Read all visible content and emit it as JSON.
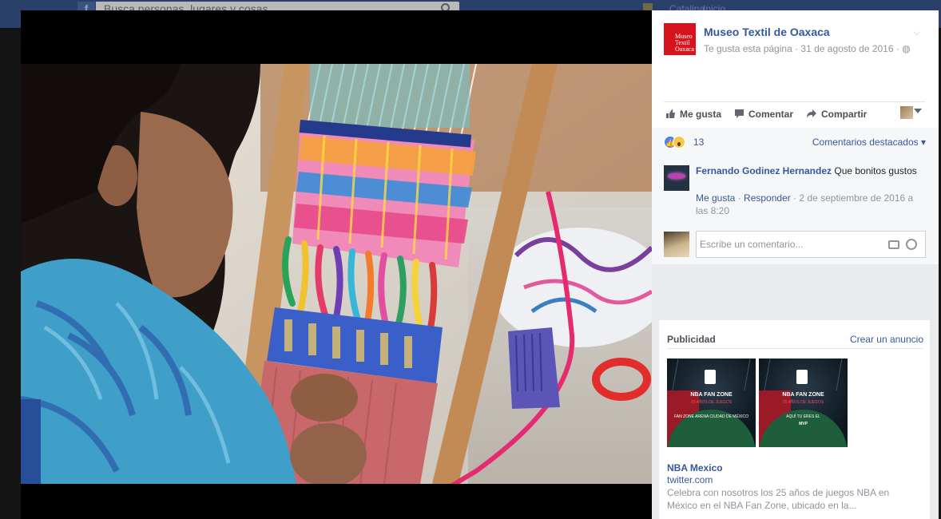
{
  "topbar": {
    "logo": "f",
    "search_placeholder": "Busca personas, lugares y cosas",
    "nav_b": "Catalina",
    "nav_c": "Inicio"
  },
  "post": {
    "page_name": "Museo Textil de Oaxaca",
    "logo_text_1": "Museo",
    "logo_text_2": "Textil",
    "logo_text_3": "Oaxaca",
    "meta": "Te gusta esta página · 31 de agosto de 2016 · ",
    "globe_icon": "globe-icon"
  },
  "actions": {
    "like": "Me gusta",
    "comment": "Comentar",
    "share": "Compartir"
  },
  "reactions": {
    "count": "13",
    "top_comments": "Comentarios destacados"
  },
  "comment": {
    "author": "Fernando Godinez Hernandez",
    "text": "Que bonitos gustos",
    "like": "Me gusta",
    "reply": "Responder",
    "timestamp": "2 de septiembre de 2016 a las 8:20"
  },
  "comment_input": {
    "placeholder": "Escribe un comentario..."
  },
  "ads": {
    "title": "Publicidad",
    "create": "Crear un anuncio",
    "image_text_a": [
      "NBA FAN ZONE",
      "25 AÑOS DE JUEGOS",
      "FAN ZONE ARENA CIUDAD DE MÉXICO",
      ""
    ],
    "image_text_b": [
      "NBA FAN ZONE",
      "25 AÑOS DE JUEGOS",
      "AQUÍ TU ERES EL",
      "MVP"
    ],
    "name": "NBA Mexico",
    "url": "twitter.com",
    "description": "Celebra con nosotros los 25 años de juegos NBA en México en el NBA Fan Zone, ubicado en la..."
  }
}
